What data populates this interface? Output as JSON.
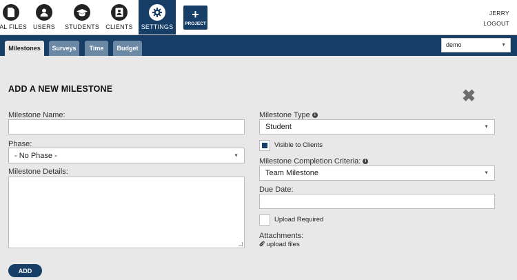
{
  "nav": {
    "items": [
      {
        "label": "BAL FILES",
        "icon": "file-icon"
      },
      {
        "label": "USERS",
        "icon": "user-icon"
      },
      {
        "label": "STUDENTS",
        "icon": "graduation-cap-icon"
      },
      {
        "label": "CLIENTS",
        "icon": "contact-card-icon"
      },
      {
        "label": "SETTINGS",
        "icon": "gear-icon"
      }
    ],
    "project_label": "PROJECT",
    "user_name": "JERRY",
    "logout_label": "LOGOUT"
  },
  "tabs": [
    {
      "label": "Milestones",
      "active": true
    },
    {
      "label": "Surveys",
      "active": false
    },
    {
      "label": "Time",
      "active": false
    },
    {
      "label": "Budget",
      "active": false
    }
  ],
  "account_select": {
    "value": "demo"
  },
  "form": {
    "title": "ADD A NEW MILESTONE",
    "milestone_name_label": "Milestone Name:",
    "milestone_name_value": "",
    "phase_label": "Phase:",
    "phase_value": "- No Phase -",
    "details_label": "Milestone Details:",
    "details_value": "",
    "type_label": "Milestone Type",
    "type_value": "Student",
    "visible_label": "Visible to Clients",
    "visible_checked": true,
    "criteria_label": "Milestone Completion Criteria:",
    "criteria_value": "Team Milestone",
    "due_date_label": "Due Date:",
    "due_date_value": "",
    "upload_required_label": "Upload Required",
    "upload_required_checked": false,
    "attachments_label": "Attachments:",
    "upload_link": "upload files",
    "add_button": "ADD"
  },
  "colors": {
    "primary": "#163e66",
    "tab_inactive": "#6b88a5",
    "background": "#e8e8e8"
  }
}
